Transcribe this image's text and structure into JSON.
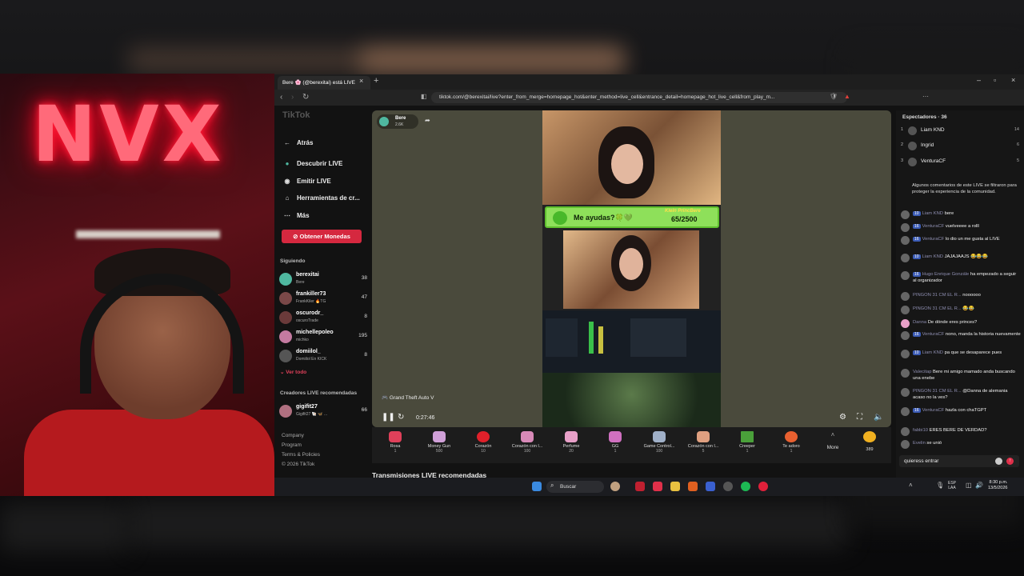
{
  "browser": {
    "tab_title": "Bere 🌸 (@berexitai) está LIVE",
    "url": "tiktok.com/@berexitai/live?enter_from_merge=homepage_hot&enter_method=live_cell&entrance_detail=homepage_hot_live_cell&from_play_m..."
  },
  "webcam": {
    "neon_text": "NVX"
  },
  "tiktok": {
    "logo": "TikTok",
    "back": "Atrás",
    "nav": [
      {
        "label": "Descubrir LIVE",
        "icon": "live-dot-icon"
      },
      {
        "label": "Emitir LIVE",
        "icon": "broadcast-icon"
      },
      {
        "label": "Herramientas de cr...",
        "icon": "tools-icon"
      },
      {
        "label": "Más",
        "icon": "more-icon"
      }
    ],
    "coins_button": "Obtener Monedas",
    "following_title": "Siguiendo",
    "following": [
      {
        "name": "berexitai",
        "sub": "Bere",
        "count": "38",
        "color": "#4fb8a0"
      },
      {
        "name": "frankiller73",
        "sub": "FrankKiler 🔥TG",
        "count": "47",
        "color": "#7a4848"
      },
      {
        "name": "oscurodr_",
        "sub": "oscuroTrade",
        "count": "8",
        "color": "#6a3a3a"
      },
      {
        "name": "michellepoleo",
        "sub": "michko",
        "count": "195",
        "color": "#c47aa0"
      },
      {
        "name": "domiilol_",
        "sub": "Domiilol En KICK",
        "count": "8",
        "color": "#555"
      }
    ],
    "see_all": "⌄ Ver todo",
    "creators_title": "Creadores LIVE recomendadas",
    "creator": {
      "name": "gigifit27",
      "sub": "Gigifit27 🐚 🦋 ...",
      "count": "66"
    },
    "footer": [
      "Company",
      "Program",
      "Terms & Policies",
      "© 2026 TikTok"
    ]
  },
  "player": {
    "streamer": "Bere",
    "likes": "2.6K",
    "goal_title": "Me ayudas?🍀💚",
    "goal_user": "Klein PrincBere",
    "goal_count": "65/2500",
    "game": "Grand Theft Auto V",
    "time": "0:27:46"
  },
  "gifts": [
    {
      "name": "Rosa",
      "price": "1",
      "color": "#e0405a"
    },
    {
      "name": "Money Gun",
      "price": "500",
      "color": "#d0a0d8"
    },
    {
      "name": "Corazón",
      "price": "10",
      "color": "#e0202a"
    },
    {
      "name": "Corazón con l...",
      "price": "100",
      "color": "#d88ab8"
    },
    {
      "name": "Perfume",
      "price": "20",
      "color": "#e8a0c8"
    },
    {
      "name": "GG",
      "price": "1",
      "color": "#d070c0"
    },
    {
      "name": "Game Control...",
      "price": "100",
      "color": "#a0b0c8"
    },
    {
      "name": "Corazón con l...",
      "price": "5",
      "color": "#e0a080"
    },
    {
      "name": "Creeper",
      "price": "1",
      "color": "#4aa03a"
    },
    {
      "name": "Te adoro",
      "price": "1",
      "color": "#e86030"
    },
    {
      "name": "More",
      "price": "",
      "color": "#333"
    }
  ],
  "coins": "389",
  "recs_title": "Transmisiones LIVE recomendadas",
  "chat": {
    "viewers_title": "Espectadores · 36",
    "viewers": [
      {
        "rank": "1",
        "name": "Liam KND",
        "score": "14"
      },
      {
        "rank": "2",
        "name": "Ingrid",
        "score": "6"
      },
      {
        "rank": "3",
        "name": "VenturaCF",
        "score": "5"
      }
    ],
    "notice": "Algunos comentarios de este LIVE se filtraron para proteger la experiencia de la comunidad.",
    "messages": [
      {
        "user": "Liam KND",
        "text": "bere",
        "lv": "10"
      },
      {
        "user": "VenturaCF",
        "text": "vuelveeee a rolll",
        "lv": "16"
      },
      {
        "user": "VenturaCF",
        "text": "lo dio un me gusta al LIVE",
        "lv": "16"
      },
      {
        "user": "Liam KND",
        "text": "JAJAJAAJS 😂😂😂",
        "lv": "10"
      },
      {
        "user": "Hugo Enrique Gonzále",
        "text": "ha empezado a seguir al organizador",
        "lv": "16"
      },
      {
        "user": "PINGON 31 CM EL R...",
        "text": "noooooo",
        "lv": ""
      },
      {
        "user": "PINGON 31 CM EL R...",
        "text": "😂😂",
        "lv": ""
      },
      {
        "user": "Danna",
        "text": "De dónde eres princes?",
        "lv": ""
      },
      {
        "user": "VenturaCF",
        "text": "nono, manda la historia nuevamente",
        "lv": "16"
      },
      {
        "user": "Liam KND",
        "text": "pa que se desaparece pues",
        "lv": "10"
      },
      {
        "user": "Valecitap",
        "text": "Bere mi amigo mamado anda buscando una enebe",
        "lv": ""
      },
      {
        "user": "PINGON 31 CM EL R...",
        "text": "@Danna de alemania acaso no la ves?",
        "lv": ""
      },
      {
        "user": "VenturaCF",
        "text": "hazla con chaTGPT",
        "lv": "16"
      },
      {
        "user": "fabbi10",
        "text": "ERES BERE DE VERDAD?",
        "lv": ""
      },
      {
        "user": "Evelin",
        "text": "se unió",
        "lv": ""
      }
    ],
    "input_value": "quieress entrar"
  },
  "taskbar": {
    "search": "Buscar",
    "lang": "ESP\nLAA",
    "time": "8:30 p.m.",
    "date": "13/5/2026"
  }
}
